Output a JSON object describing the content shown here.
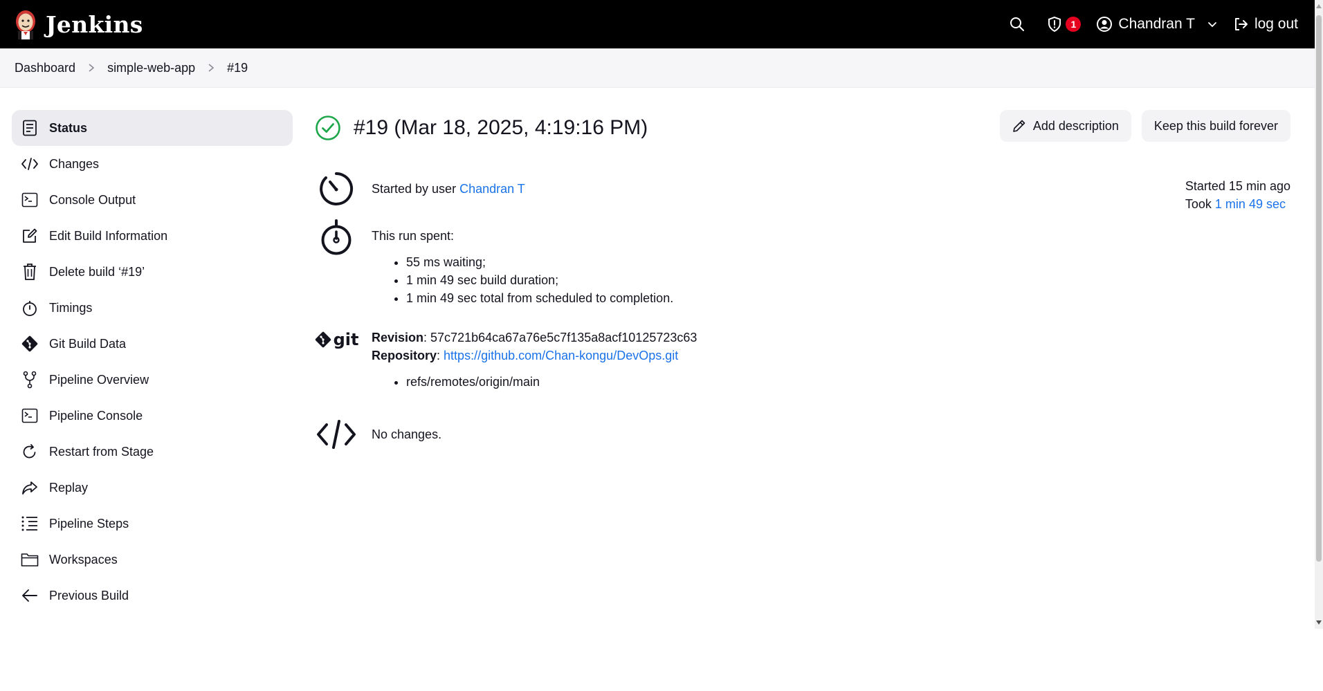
{
  "header": {
    "brand": "Jenkins",
    "security_count": "1",
    "user_name": "Chandran T",
    "logout_label": "log out"
  },
  "breadcrumb": {
    "items": [
      "Dashboard",
      "simple-web-app",
      "#19"
    ]
  },
  "sidebar": {
    "items": [
      {
        "label": "Status",
        "icon": "status-doc-icon",
        "active": true
      },
      {
        "label": "Changes",
        "icon": "code-icon"
      },
      {
        "label": "Console Output",
        "icon": "terminal-icon"
      },
      {
        "label": "Edit Build Information",
        "icon": "edit-icon"
      },
      {
        "label": "Delete build ‘#19’",
        "icon": "trash-icon"
      },
      {
        "label": "Timings",
        "icon": "stopwatch-icon"
      },
      {
        "label": "Git Build Data",
        "icon": "git-icon"
      },
      {
        "label": "Pipeline Overview",
        "icon": "branch-icon"
      },
      {
        "label": "Pipeline Console",
        "icon": "terminal-icon"
      },
      {
        "label": "Restart from Stage",
        "icon": "restart-icon"
      },
      {
        "label": "Replay",
        "icon": "replay-icon"
      },
      {
        "label": "Pipeline Steps",
        "icon": "steps-list-icon"
      },
      {
        "label": "Workspaces",
        "icon": "folder-icon"
      },
      {
        "label": "Previous Build",
        "icon": "arrow-left-icon"
      }
    ]
  },
  "build": {
    "title": "#19 (Mar 18, 2025, 4:19:16 PM)",
    "status_color": "#1ea64b",
    "add_description_label": "Add description",
    "keep_forever_label": "Keep this build forever",
    "started_by_prefix": "Started by user ",
    "started_by_user": "Chandran T",
    "started_ago": "Started 15 min ago",
    "took_prefix": "Took ",
    "took_value": "1 min 49 sec",
    "run_spent_label": "This run spent:",
    "run_spent_items": [
      "55 ms waiting;",
      "1 min 49 sec build duration;",
      "1 min 49 sec total from scheduled to completion."
    ],
    "revision_label": "Revision",
    "revision_value": ": 57c721b64ca67a76e5c7f135a8acf10125723c63",
    "repository_label": "Repository",
    "repository_sep": ": ",
    "repository_url": "https://github.com/Chan-kongu/DevOps.git",
    "refs": [
      "refs/remotes/origin/main"
    ],
    "git_logo_text": "git",
    "changes_text": "No changes."
  }
}
